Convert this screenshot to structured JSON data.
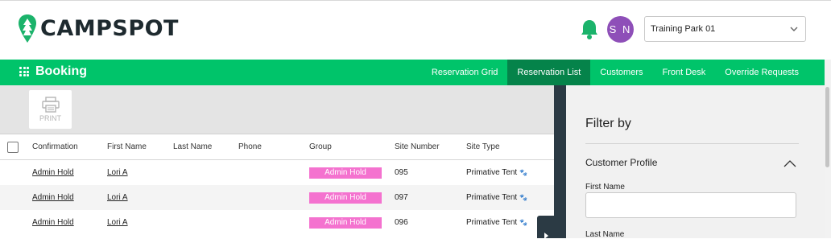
{
  "header": {
    "logo_text": "CAMPSPOT",
    "avatar_initials": "S N",
    "park_select_value": "Training Park 01"
  },
  "nav": {
    "title": "Booking",
    "links": [
      {
        "label": "Reservation Grid",
        "active": false
      },
      {
        "label": "Reservation List",
        "active": true
      },
      {
        "label": "Customers",
        "active": false
      },
      {
        "label": "Front Desk",
        "active": false
      },
      {
        "label": "Override Requests",
        "active": false
      }
    ]
  },
  "toolbar": {
    "print_label": "PRINT"
  },
  "table": {
    "columns": [
      "Confirmation",
      "First Name",
      "Last Name",
      "Phone",
      "Group",
      "Site Number",
      "Site Type"
    ],
    "rows": [
      {
        "confirmation": "Admin Hold",
        "first_name": "Lori A",
        "last_name": "",
        "phone": "",
        "group": "Admin Hold",
        "site_number": "095",
        "site_type": "Primative Tent"
      },
      {
        "confirmation": "Admin Hold",
        "first_name": "Lori A",
        "last_name": "",
        "phone": "",
        "group": "Admin Hold",
        "site_number": "097",
        "site_type": "Primative Tent"
      },
      {
        "confirmation": "Admin Hold",
        "first_name": "Lori A",
        "last_name": "",
        "phone": "",
        "group": "Admin Hold",
        "site_number": "096",
        "site_type": "Primative Tent"
      }
    ]
  },
  "filter": {
    "title": "Filter by",
    "section": "Customer Profile",
    "first_name_label": "First Name",
    "last_name_label": "Last Name"
  },
  "colors": {
    "brand_green": "#00c46a",
    "active_nav": "#05834a",
    "hold_pink": "#f472cf",
    "avatar_purple": "#8e4fb8"
  },
  "icons": {
    "logo": "tree-pin-icon",
    "bell": "bell-icon",
    "print": "printer-icon",
    "site_type": "paw-icon"
  }
}
